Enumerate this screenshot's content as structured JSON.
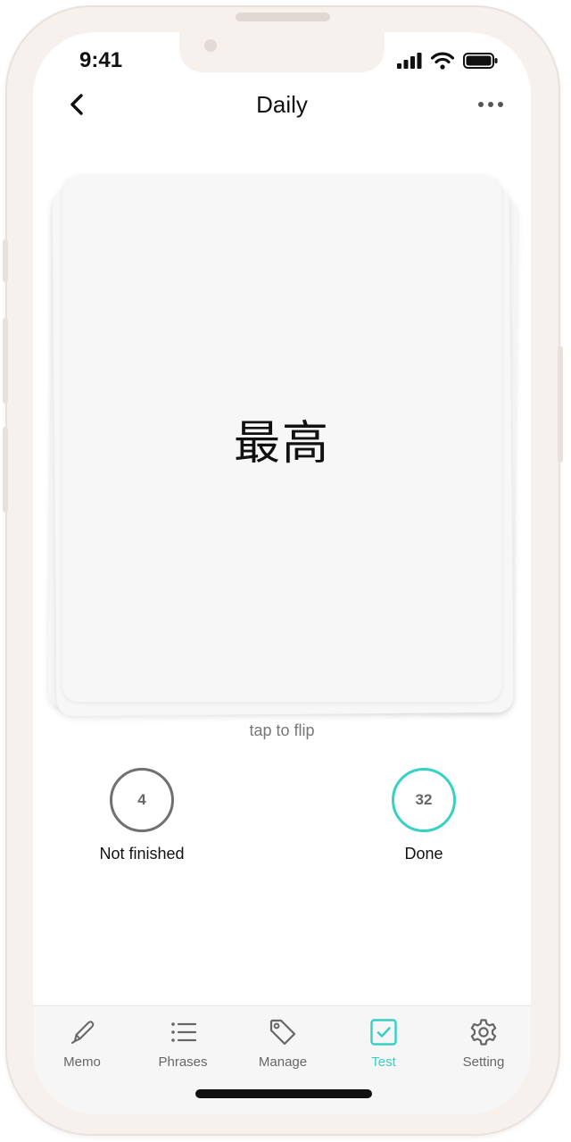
{
  "status_bar": {
    "time": "9:41",
    "icons": [
      "signal-icon",
      "wifi-icon",
      "battery-icon"
    ]
  },
  "header": {
    "title": "Daily",
    "back_icon": "chevron-left-icon",
    "more_icon": "more-horizontal-icon"
  },
  "card": {
    "word": "最高",
    "hint": "tap to flip"
  },
  "counters": {
    "not_finished": {
      "value": "4",
      "label": "Not finished"
    },
    "done": {
      "value": "32",
      "label": "Done"
    }
  },
  "tabs": [
    {
      "label": "Memo",
      "icon": "pencil-icon",
      "active": false
    },
    {
      "label": "Phrases",
      "icon": "list-icon",
      "active": false
    },
    {
      "label": "Manage",
      "icon": "tag-icon",
      "active": false
    },
    {
      "label": "Test",
      "icon": "checkbox-icon",
      "active": true
    },
    {
      "label": "Setting",
      "icon": "gear-icon",
      "active": false
    }
  ],
  "colors": {
    "accent": "#36d1c4",
    "text": "#111111",
    "muted": "#666666",
    "card": "#f7f7f7",
    "frame": "#f6f1ed",
    "counter_ring_gray": "#707070"
  }
}
